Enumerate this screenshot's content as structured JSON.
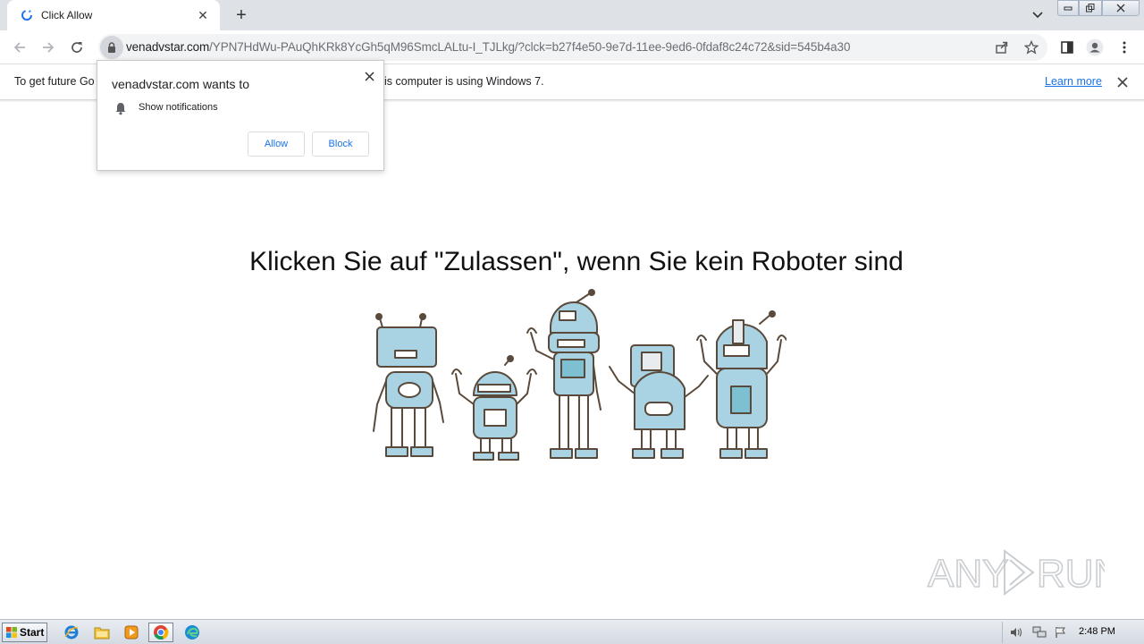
{
  "browser": {
    "tab_title": "Click Allow",
    "url_host": "venadvstar.com",
    "url_path": "/YPN7HdWu-PAuQhKRk8YcGh5qM96SmcLALtu-I_TJLkg/?clck=b27f4e50-9e7d-11ee-9ed6-0fdaf8c24c72&sid=545b4a30"
  },
  "infobar": {
    "text_start": "To get future Go",
    "text_end": "is computer is using Windows 7.",
    "link": "Learn more"
  },
  "prompt": {
    "title": "venadvstar.com wants to",
    "permission": "Show notifications",
    "allow_label": "Allow",
    "block_label": "Block"
  },
  "page": {
    "headline": "Klicken Sie auf \"Zulassen\", wenn Sie kein Roboter sind"
  },
  "watermark": {
    "text_left": "ANY",
    "text_right": "RUN"
  },
  "taskbar": {
    "start_label": "Start",
    "clock": "2:48 PM"
  },
  "colors": {
    "link_blue": "#1a73e8",
    "robot_blue": "#a9d3e3",
    "robot_outline": "#5a4a3c"
  }
}
